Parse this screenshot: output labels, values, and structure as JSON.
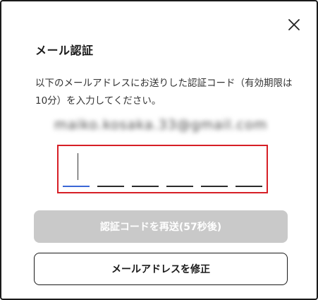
{
  "dialog": {
    "title": "メール認証",
    "description": "以下のメールアドレスにお送りした認証コード（有効期限は10分）を入力してください。",
    "email": "maiko.kosaka.33@gmail.com",
    "close_icon": "close-icon"
  },
  "code_input": {
    "digit_count": 6,
    "active_index": 0,
    "highlight_color": "#d61f26",
    "active_underline_color": "#3b67d6",
    "values": [
      "",
      "",
      "",
      "",
      "",
      ""
    ]
  },
  "buttons": {
    "resend_label": "認証コードを再送(57秒後)",
    "resend_disabled": true,
    "edit_email_label": "メールアドレスを修正"
  }
}
